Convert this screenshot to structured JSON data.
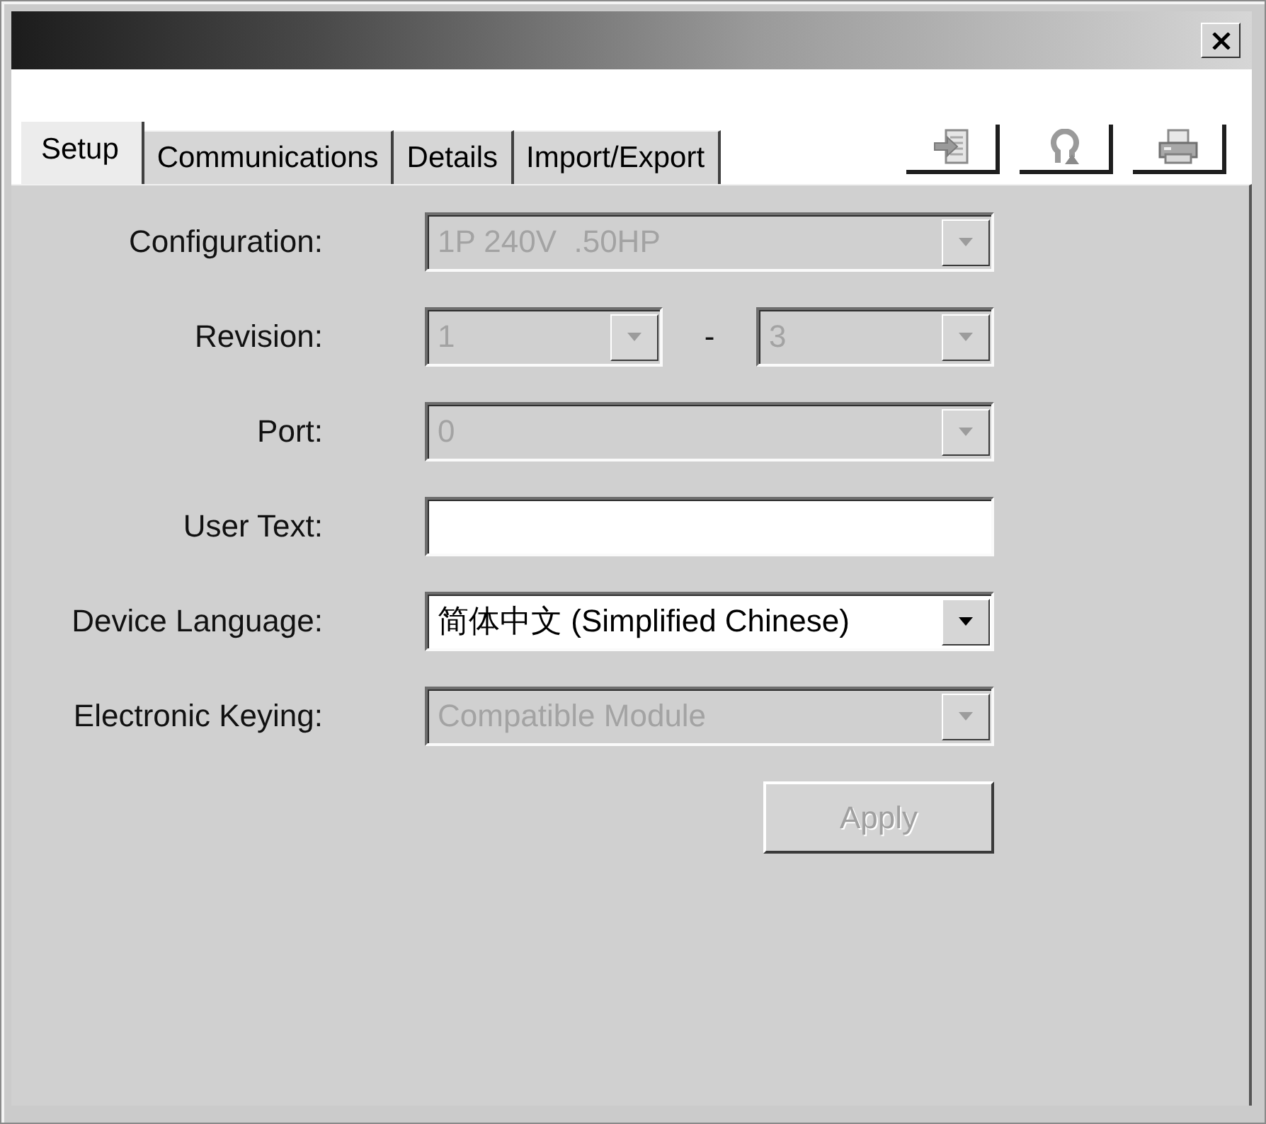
{
  "tabs": [
    {
      "label": "Setup",
      "selected": true
    },
    {
      "label": "Communications",
      "selected": false
    },
    {
      "label": "Details",
      "selected": false
    },
    {
      "label": "Import/Export",
      "selected": false
    }
  ],
  "form": {
    "fields": [
      {
        "label": "Configuration:",
        "kind": "dropdown",
        "value": "1P 240V  .50HP",
        "disabled": true
      },
      {
        "label": "Revision:",
        "kind": "dropdown_pair",
        "separator": "-",
        "parts": [
          {
            "value": "1",
            "disabled": true
          },
          {
            "value": "3",
            "disabled": true
          }
        ]
      },
      {
        "label": "Port:",
        "kind": "dropdown",
        "value": "0",
        "disabled": true
      },
      {
        "label": "User Text:",
        "kind": "text",
        "disabled": false
      },
      {
        "label": "Device Language:",
        "kind": "dropdown",
        "value": "简体中文 (Simplified Chinese)",
        "disabled": false
      },
      {
        "label": "Electronic Keying:",
        "kind": "dropdown",
        "value": "Compatible Module",
        "disabled": true
      }
    ]
  },
  "apply_button": {
    "label": "Apply",
    "disabled": true
  }
}
